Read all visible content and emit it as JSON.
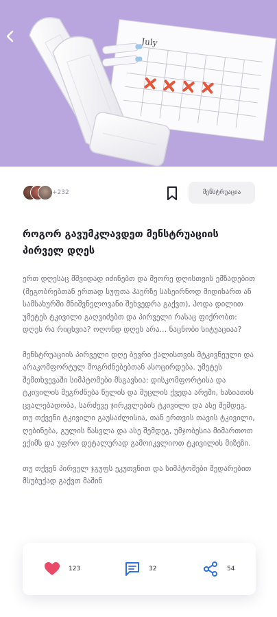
{
  "hero": {
    "calendar_month": "July",
    "image_icon": "menstrual-products-photo"
  },
  "nav": {
    "back_icon": "chevron-left-icon"
  },
  "meta": {
    "avatar_count": "+232",
    "bookmark_icon": "bookmark-icon",
    "category": "მენსტრუაცია"
  },
  "article": {
    "title": "როგორ გავუმკლავდეთ მენსტრუაციის პირველ დღეს",
    "paragraphs": [
      "ერთ დღესაც მშვიდად იძინებთ და მეორე დღისთვის ემზადებით (მეგობრებთან ერთად სუფთა ჰაერზე სასეირნოდ მიდიხართ ან სამსახურში მნიშვნელოვანი შეხვედრა გაქვთ), ჰოდა დილით უმეტეს ტკივილი გაღვიძებთ და პირველი რასაც ფიქრობთ: დღეს რა რიცხვია? ოღონდ დღეს არა... ნაცნობი სიტუაციაა?",
      "მენსტრუაციის პირველი დღე ბევრი ქალისთვის მტკივნეული და არაკომფორტულ შოგრძნებებთან ასოცირდება. უმეტეს შემთხვევაში სიმპტომები მსგავსია: დისკომფორტისა და ტკივილის შეგრძნება წელის და მუცლის ქვედა არეში, ხასიათის ცვალებადობა, სარძევე ჯირკვლების ტკივილი და ასე შემდეგ. თუ თქვენი ტკივილი გაუსაძლისია, თან ერთვის თავის ტკივილი, ღებინება, გულის წასვლა და ასე შემდეგ, უმჯობესია მიმართოთ ექიმს და უფრო დეტალურად გამოიკვლიოთ ტკივილის მიზეზი.",
      "თუ თქვენ პირველ ჯგუფს ეკუთვნით და სიმპტომები შედარებით მსუბუქად გაქვთ მაშინ"
    ]
  },
  "actions": {
    "like": {
      "icon": "heart-icon",
      "count": "123"
    },
    "comment": {
      "icon": "comment-icon",
      "count": "32"
    },
    "share": {
      "icon": "share-icon",
      "count": "54"
    }
  },
  "colors": {
    "hero_bg": "#b9a6de",
    "heart": "#e84a68",
    "accent_blue": "#2f6fe4",
    "chip_bg": "#f1f1f4"
  }
}
